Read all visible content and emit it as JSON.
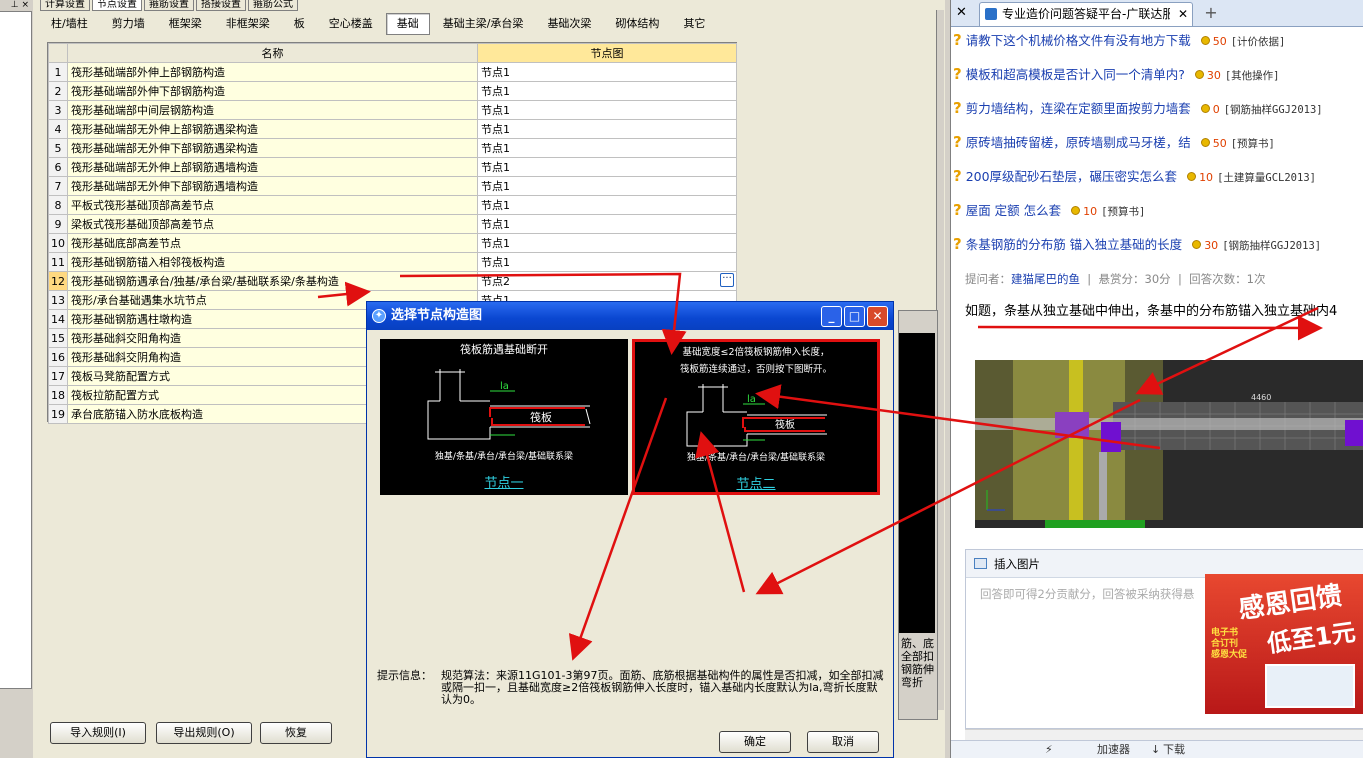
{
  "left_strip": {
    "header": "⊥ ×"
  },
  "top_tabs": [
    "计算设置",
    "节点设置",
    "箍筋设置",
    "搭接设置",
    "箍筋公式"
  ],
  "category_tabs": [
    "柱/墙柱",
    "剪力墙",
    "框架梁",
    "非框架梁",
    "板",
    "空心楼盖",
    "基础",
    "基础主梁/承台梁",
    "基础次梁",
    "砌体结构",
    "其它"
  ],
  "active_category": "基础",
  "grid": {
    "col_name": "名称",
    "col_node": "节点图",
    "rows": [
      {
        "n": "1",
        "name": "筏形基础端部外伸上部钢筋构造",
        "val": "节点1"
      },
      {
        "n": "2",
        "name": "筏形基础端部外伸下部钢筋构造",
        "val": "节点1"
      },
      {
        "n": "3",
        "name": "筏形基础端部中间层钢筋构造",
        "val": "节点1"
      },
      {
        "n": "4",
        "name": "筏形基础端部无外伸上部钢筋遇梁构造",
        "val": "节点1"
      },
      {
        "n": "5",
        "name": "筏形基础端部无外伸下部钢筋遇梁构造",
        "val": "节点1"
      },
      {
        "n": "6",
        "name": "筏形基础端部无外伸上部钢筋遇墙构造",
        "val": "节点1"
      },
      {
        "n": "7",
        "name": "筏形基础端部无外伸下部钢筋遇墙构造",
        "val": "节点1"
      },
      {
        "n": "8",
        "name": "平板式筏形基础顶部高差节点",
        "val": "节点1"
      },
      {
        "n": "9",
        "name": "梁板式筏形基础顶部高差节点",
        "val": "节点1"
      },
      {
        "n": "10",
        "name": "筏形基础底部高差节点",
        "val": "节点1"
      },
      {
        "n": "11",
        "name": "筏形基础钢筋锚入相邻筏板构造",
        "val": "节点1"
      },
      {
        "n": "12",
        "name": "筏形基础钢筋遇承台/独基/承台梁/基础联系梁/条基构造",
        "val": "节点2"
      },
      {
        "n": "13",
        "name": "筏形/承台基础遇集水坑节点",
        "val": "节点1"
      },
      {
        "n": "14",
        "name": "筏形基础钢筋遇柱墩构造",
        "val": ""
      },
      {
        "n": "15",
        "name": "筏形基础斜交阳角构造",
        "val": ""
      },
      {
        "n": "16",
        "name": "筏形基础斜交阴角构造",
        "val": ""
      },
      {
        "n": "17",
        "name": "筏板马凳筋配置方式",
        "val": ""
      },
      {
        "n": "18",
        "name": "筏板拉筋配置方式",
        "val": ""
      },
      {
        "n": "19",
        "name": "承台底筋锚入防水底板构造",
        "val": ""
      }
    ]
  },
  "bottom_buttons": {
    "import": "导入规则(I)",
    "export": "导出规则(O)",
    "restore": "恢复"
  },
  "behind_text": "筋、底 全部扣 钢筋伸 弯折",
  "dialog": {
    "title": "选择节点构造图",
    "panel1": {
      "title": "筏板筋遇基础断开",
      "caption": "独基/条基/承台/承台梁/基础联系梁",
      "link": "节点一",
      "slab": "筏板",
      "la": "la"
    },
    "panel2": {
      "title_line1": "基础宽度≤2倍筏板钢筋伸入长度，",
      "title_line2": "筏板筋连续通过，否则按下图断开。",
      "caption": "独基/条基/承台/承台梁/基础联系梁",
      "link": "节点二",
      "slab": "筏板",
      "la": "la"
    },
    "hint_label": "提示信息：",
    "hint_text": "规范算法：来源11G101-3第97页。面筋、底筋根据基础构件的属性是否扣减，如全部扣减或隔一扣一，且基础宽度≥2倍筏板钢筋伸入长度时，锚入基础内长度默认为la,弯折长度默认为0。",
    "ok": "确定",
    "cancel": "取消"
  },
  "browser": {
    "tab_title": "专业造价问题答疑平台-广联达服务新干线",
    "questions": [
      {
        "text": "请教下这个机械价格文件有没有地方下载",
        "points": "50",
        "tag": "[计价依据]"
      },
      {
        "text": "模板和超高模板是否计入同一个清单内?",
        "points": "30",
        "tag": "[其他操作]"
      },
      {
        "text": "剪力墙结构，连梁在定额里面按剪力墙套",
        "points": "0",
        "tag": "[钢筋抽样GGJ2013]"
      },
      {
        "text": "原砖墙抽砖留槎，原砖墙剔成马牙槎，结",
        "points": "50",
        "tag": "[预算书]"
      },
      {
        "text": "200厚级配砂石垫层，碾压密实怎么套",
        "points": "10",
        "tag": "[土建算量GCL2013]"
      },
      {
        "text": "屋面 定额 怎么套",
        "points": "10",
        "tag": "[预算书]"
      },
      {
        "text": "条基钢筋的分布筋 锚入独立基础的长度",
        "points": "30",
        "tag": "[钢筋抽样GGJ2013]"
      }
    ],
    "meta_label_asker": "提问者：",
    "meta_asker": "建猫尾巴的鱼",
    "meta_reward": "悬赏分：30分",
    "meta_answers": "回答次数：1次",
    "question_body": "如题，条基从独立基础中伸出，条基中的分布筋锚入独立基础内4",
    "cad_dim": "4460",
    "insert_image": "插入图片",
    "answer_placeholder": "回答即可得2分贡献分，回答被采纳获得悬",
    "ad_line1": "感恩回馈",
    "ad_line2": "低至1元",
    "ad_side": "电子书 合订刊 感恩大促",
    "status_items": [
      "加速器",
      "下载"
    ]
  }
}
